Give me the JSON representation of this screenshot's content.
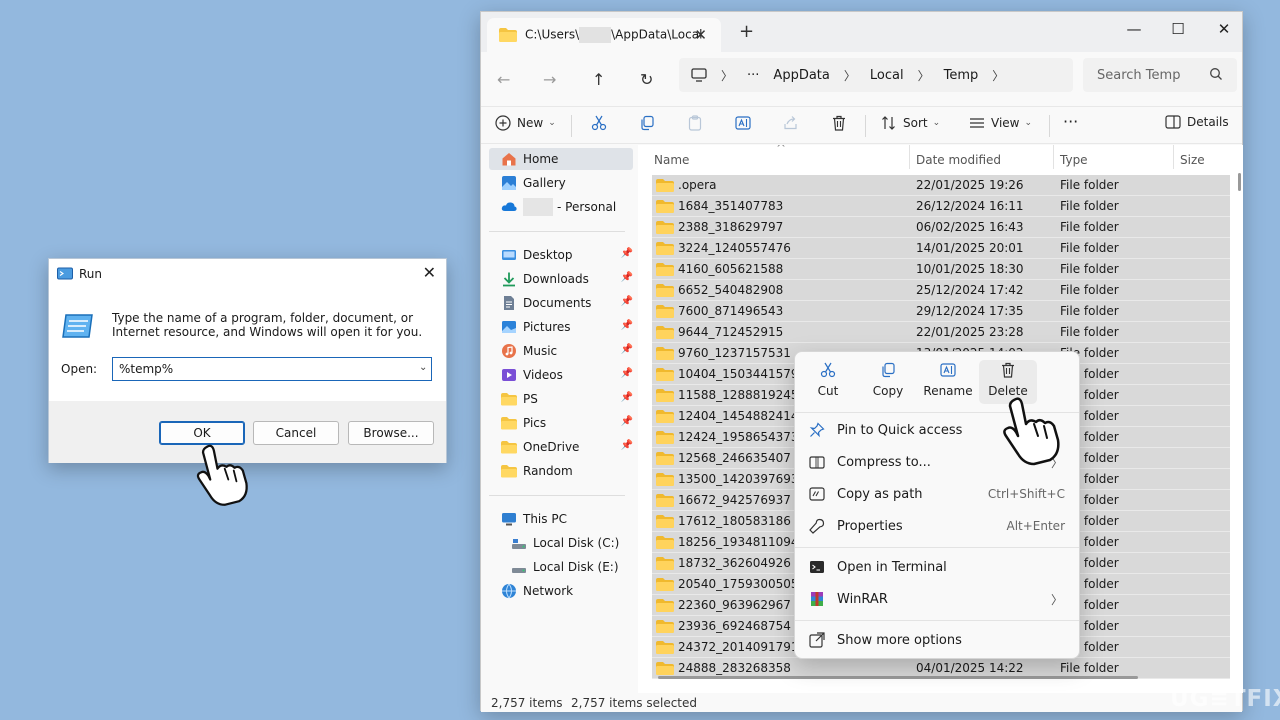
{
  "explorer": {
    "tab": {
      "title_prefix": "C:\\Users\\",
      "title_suffix": "\\AppData\\Local"
    },
    "address": {
      "more": "···",
      "crumbs": [
        "AppData",
        "Local",
        "Temp"
      ]
    },
    "search": {
      "placeholder": "Search Temp"
    },
    "toolbar": {
      "new_label": "New",
      "sort_label": "Sort",
      "view_label": "View",
      "more_label": "···",
      "details_label": "Details"
    },
    "sidebar": {
      "home": "Home",
      "gallery": "Gallery",
      "personal": "- Personal",
      "quick": [
        "Desktop",
        "Downloads",
        "Documents",
        "Pictures",
        "Music",
        "Videos",
        "PS",
        "Pics",
        "OneDrive",
        "Random"
      ],
      "this_pc": "This PC",
      "drives": [
        "Local Disk (C:)",
        "Local Disk (E:)"
      ],
      "network": "Network"
    },
    "columns": {
      "name": "Name",
      "date": "Date modified",
      "type": "Type",
      "size": "Size"
    },
    "files": [
      {
        "name": ".opera",
        "date": "22/01/2025 19:26",
        "type": "File folder"
      },
      {
        "name": "1684_351407783",
        "date": "26/12/2024 16:11",
        "type": "File folder"
      },
      {
        "name": "2388_318629797",
        "date": "06/02/2025 16:43",
        "type": "File folder"
      },
      {
        "name": "3224_1240557476",
        "date": "14/01/2025 20:01",
        "type": "File folder"
      },
      {
        "name": "4160_605621588",
        "date": "10/01/2025 18:30",
        "type": "File folder"
      },
      {
        "name": "6652_540482908",
        "date": "25/12/2024 17:42",
        "type": "File folder"
      },
      {
        "name": "7600_871496543",
        "date": "29/12/2024 17:35",
        "type": "File folder"
      },
      {
        "name": "9644_712452915",
        "date": "22/01/2025 23:28",
        "type": "File folder"
      },
      {
        "name": "9760_1237157531",
        "date": "13/01/2025 14:02",
        "type": "File folder"
      },
      {
        "name": "10404_1503441579",
        "date": "",
        "type": "File folder"
      },
      {
        "name": "11588_1288819245",
        "date": "",
        "type": "File folder"
      },
      {
        "name": "12404_1454882414",
        "date": "",
        "type": "File folder"
      },
      {
        "name": "12424_1958654373",
        "date": "",
        "type": "File folder"
      },
      {
        "name": "12568_246635407",
        "date": "",
        "type": "File folder"
      },
      {
        "name": "13500_1420397693",
        "date": "",
        "type": "File folder"
      },
      {
        "name": "16672_942576937",
        "date": "",
        "type": "File folder"
      },
      {
        "name": "17612_180583186",
        "date": "",
        "type": "File folder"
      },
      {
        "name": "18256_1934811094",
        "date": "",
        "type": "File folder"
      },
      {
        "name": "18732_362604926",
        "date": "",
        "type": "File folder"
      },
      {
        "name": "20540_1759300505",
        "date": "",
        "type": "File folder"
      },
      {
        "name": "22360_963962967",
        "date": "",
        "type": "File folder"
      },
      {
        "name": "23936_692468754",
        "date": "",
        "type": "File folder"
      },
      {
        "name": "24372_2014091791",
        "date": "",
        "type": "File folder"
      },
      {
        "name": "24888_283268358",
        "date": "04/01/2025 14:22",
        "type": "File folder"
      }
    ],
    "status": {
      "count": "2,757 items",
      "selected": "2,757 items selected"
    }
  },
  "context_menu": {
    "actions": [
      "Cut",
      "Copy",
      "Rename",
      "Delete"
    ],
    "items": [
      {
        "label": "Pin to Quick access",
        "shortcut": ""
      },
      {
        "label": "Compress to...",
        "shortcut": ""
      },
      {
        "label": "Copy as path",
        "shortcut": "Ctrl+Shift+C"
      },
      {
        "label": "Properties",
        "shortcut": "Alt+Enter"
      },
      {
        "label": "Open in Terminal",
        "shortcut": ""
      },
      {
        "label": "WinRAR",
        "shortcut": ""
      },
      {
        "label": "Show more options",
        "shortcut": ""
      }
    ]
  },
  "run_dialog": {
    "title": "Run",
    "description": "Type the name of a program, folder, document, or Internet resource, and Windows will open it for you.",
    "open_label": "Open:",
    "input_value": "%temp%",
    "ok": "OK",
    "cancel": "Cancel",
    "browse": "Browse..."
  },
  "watermark": "UG≡TFIX"
}
